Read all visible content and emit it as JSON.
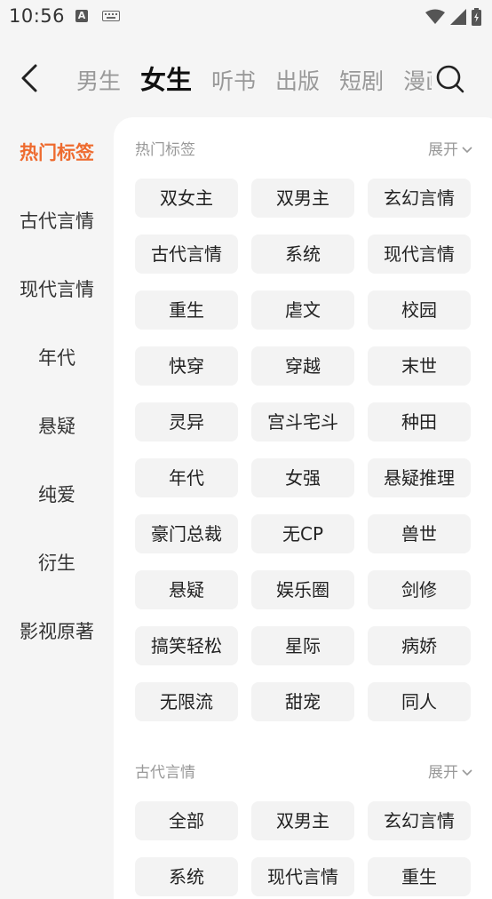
{
  "status": {
    "time": "10:56"
  },
  "header": {
    "tabs": [
      {
        "label": "男生",
        "active": false
      },
      {
        "label": "女生",
        "active": true
      },
      {
        "label": "听书",
        "active": false
      },
      {
        "label": "出版",
        "active": false
      },
      {
        "label": "短剧",
        "active": false
      },
      {
        "label": "漫画",
        "active": false
      }
    ]
  },
  "sidebar": {
    "items": [
      {
        "label": "热门标签",
        "active": true
      },
      {
        "label": "古代言情",
        "active": false
      },
      {
        "label": "现代言情",
        "active": false
      },
      {
        "label": "年代",
        "active": false
      },
      {
        "label": "悬疑",
        "active": false
      },
      {
        "label": "纯爱",
        "active": false
      },
      {
        "label": "衍生",
        "active": false
      },
      {
        "label": "影视原著",
        "active": false
      }
    ]
  },
  "sections": [
    {
      "title": "热门标签",
      "expand_label": "展开",
      "tags": [
        "双女主",
        "双男主",
        "玄幻言情",
        "古代言情",
        "系统",
        "现代言情",
        "重生",
        "虐文",
        "校园",
        "快穿",
        "穿越",
        "末世",
        "灵异",
        "宫斗宅斗",
        "种田",
        "年代",
        "女强",
        "悬疑推理",
        "豪门总裁",
        "无CP",
        "兽世",
        "悬疑",
        "娱乐圈",
        "剑修",
        "搞笑轻松",
        "星际",
        "病娇",
        "无限流",
        "甜宠",
        "同人"
      ]
    },
    {
      "title": "古代言情",
      "expand_label": "展开",
      "tags": [
        "全部",
        "双男主",
        "玄幻言情",
        "系统",
        "现代言情",
        "重生"
      ]
    }
  ],
  "colors": {
    "accent": "#ee6b2f",
    "tag_bg": "#f3f3f3",
    "muted": "#999999"
  }
}
